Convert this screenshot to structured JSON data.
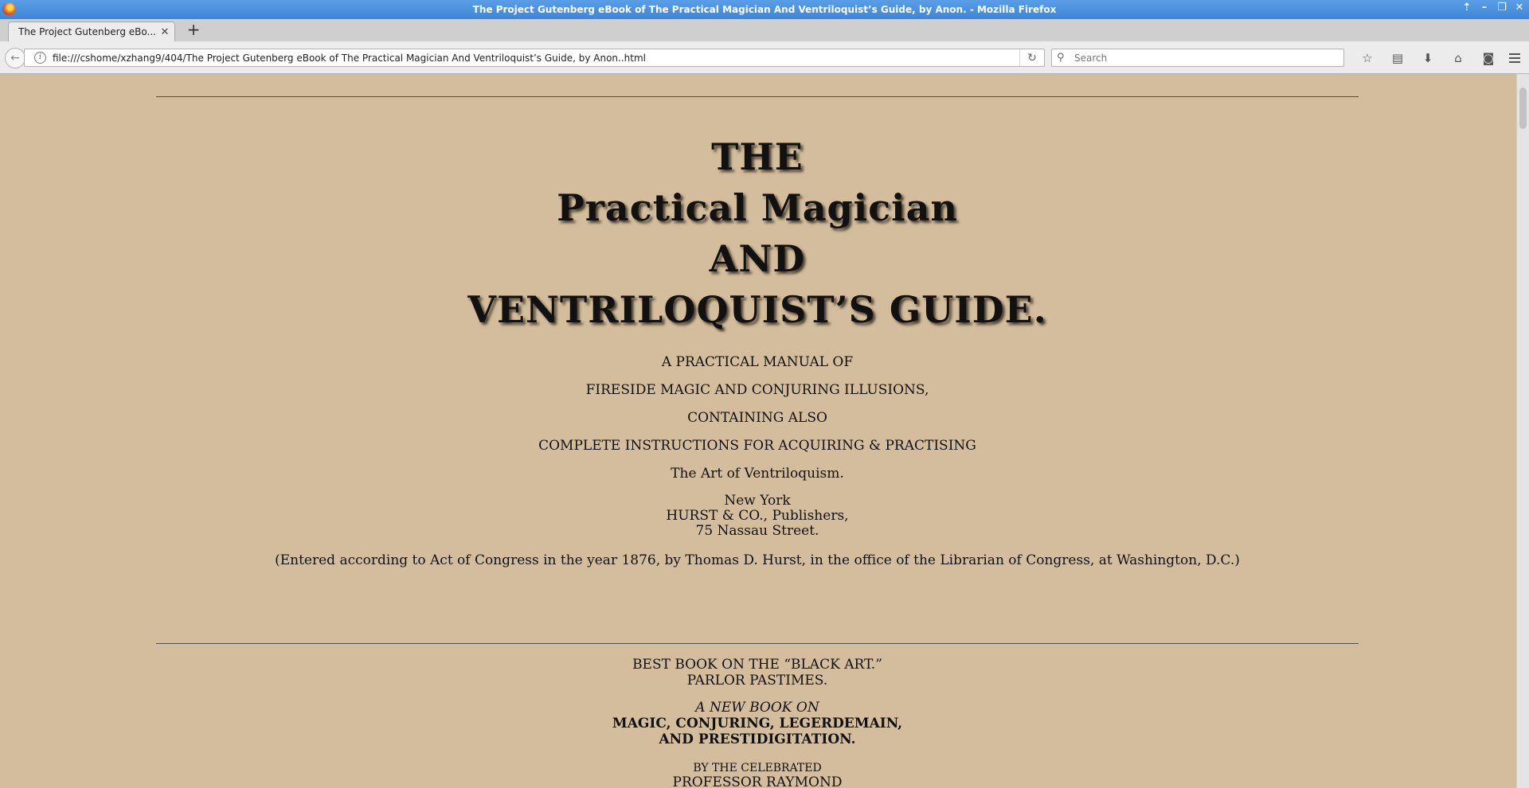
{
  "window": {
    "title": "The Project Gutenberg eBook of The Practical Magician And Ventriloquist’s Guide, by Anon. - Mozilla Firefox",
    "controls": [
      "⇡",
      "–",
      "❐",
      "✕"
    ]
  },
  "tabs": [
    {
      "title": "The Project Gutenberg eBo...",
      "close": "✕"
    }
  ],
  "new_tab": "+",
  "navbar": {
    "back": "←",
    "url": "file:///cshome/xzhang9/404/The Project Gutenberg eBook of The Practical Magician And Ventriloquist’s Guide, by Anon..html",
    "reload": "↻",
    "search_placeholder": "Search",
    "icons": [
      "star-icon",
      "reading-list-icon",
      "download-icon",
      "home-icon",
      "pocket-icon",
      "menu-icon"
    ]
  },
  "page": {
    "title_lines": [
      "THE",
      "Practical Magician",
      "AND",
      "VENTRILOQUIST’S GUIDE."
    ],
    "subtitle_lines": [
      "A PRACTICAL MANUAL OF",
      "FIRESIDE MAGIC AND CONJURING ILLUSIONS,",
      "CONTAINING ALSO",
      "COMPLETE INSTRUCTIONS FOR ACQUIRING & PRACTISING",
      "The Art of Ventriloquism."
    ],
    "imprint": [
      "New York",
      "HURST & CO., Publishers,",
      "75 Nassau Street."
    ],
    "copyright": "(Entered according to Act of Congress in the year 1876, by Thomas D. Hurst, in the office of the Librarian of Congress, at Washington, D.C.)",
    "ad": {
      "line1": "BEST BOOK ON THE “BLACK ART.”",
      "line2": "PARLOR PASTIMES.",
      "italic": "A NEW BOOK ON",
      "bold1": "MAGIC, CONJURING, LEGERDEMAIN,",
      "bold2": "AND PRESTIDIGITATION.",
      "by": "BY THE CELEBRATED",
      "author": "PROFESSOR RAYMOND"
    }
  }
}
